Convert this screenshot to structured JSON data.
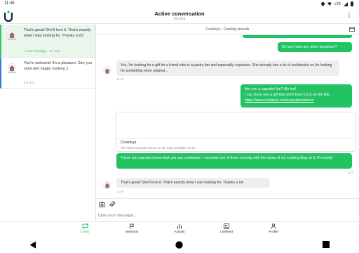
{
  "status_bar": {
    "time": "11:49",
    "network": "LTE"
  },
  "header": {
    "title": "Active conversation",
    "subtitle": "6m 22s"
  },
  "sidebar": {
    "conversations": [
      {
        "preview": "That's great! She'll love it. That's exactly what I was looking for. Thanks a lot!",
        "status": "1 new message",
        "time": "1m 42s"
      },
      {
        "preview": "You're welcome! It's a pleasure. See you soon and happy cooking ;)",
        "time": "1m 37s"
      }
    ]
  },
  "chat": {
    "topic": "Cooktoys - Cooking utensils",
    "messages": [
      {
        "text": "Do you have any other questions?"
      },
      {
        "text": "Yes, I'm looking for a gift for a friend who is a pastry fan and especially cupcakes. She already has a lot of cookbooks so I'm looking for something more original...",
        "time": "11:46"
      },
      {
        "line1": "Are you a cupcake fan? Me too!",
        "line2": "I can show you a gift that she'll love! Click on the link:",
        "link": "https://www.cooktoys.com/cupcakes/boxes"
      },
      {
        "text": "These are cupcake boxes that you can customize. I received one of them recently with the name of my cooking blog on it. It's lovely!",
        "time": "11:47"
      },
      {
        "text": "That's great! She'll love it. That's exactly what I was looking for. Thanks a lot!",
        "time": "11:48"
      }
    ],
    "link_card": {
      "title": "Cooktoys",
      "description": "The finest cupcake boxes at the best possible prices"
    }
  },
  "composer": {
    "placeholder": "Type your message..."
  },
  "tabs": [
    {
      "label": "Chats",
      "icon": "chat-bubble-icon",
      "active": true
    },
    {
      "label": "Missions",
      "icon": "flag-icon"
    },
    {
      "label": "Activity",
      "icon": "bar-chart-icon"
    },
    {
      "label": "Livefeed",
      "icon": "livefeed-icon"
    },
    {
      "label": "Profile",
      "icon": "person-icon"
    }
  ],
  "colors": {
    "accent": "#23c262",
    "bubble_in": "#eeeeee"
  }
}
